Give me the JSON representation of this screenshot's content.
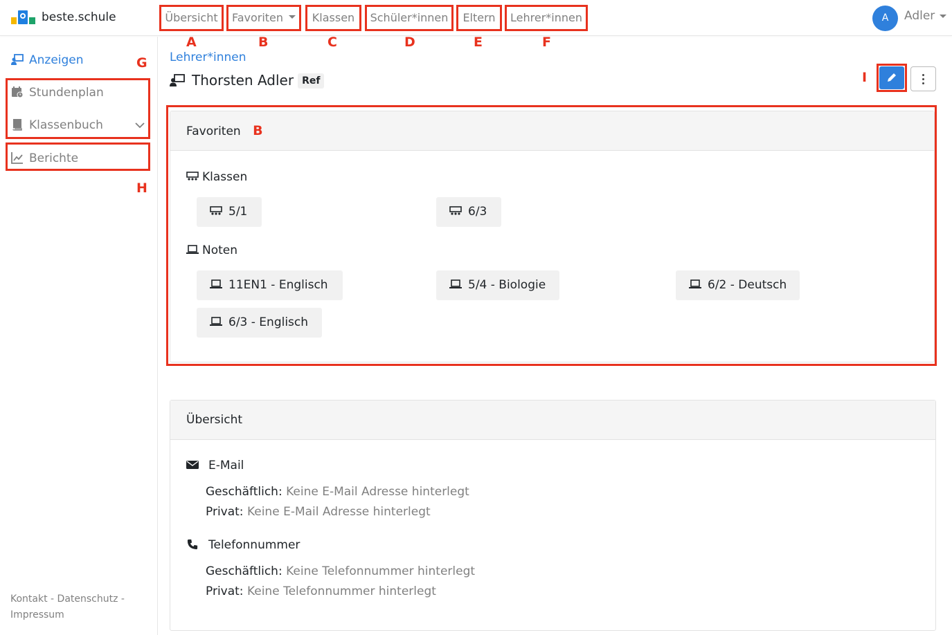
{
  "app": {
    "brand": "beste.schule"
  },
  "nav": {
    "items": [
      {
        "label": "Übersicht",
        "marker": "A"
      },
      {
        "label": "Favoriten",
        "marker": "B"
      },
      {
        "label": "Klassen",
        "marker": "C"
      },
      {
        "label": "Schüler*innen",
        "marker": "D"
      },
      {
        "label": "Eltern",
        "marker": "E"
      },
      {
        "label": "Lehrer*innen",
        "marker": "F"
      }
    ]
  },
  "user": {
    "initial": "A",
    "name": "Adler"
  },
  "sidebar": {
    "items": [
      {
        "label": "Anzeigen",
        "icon": "person-board-icon",
        "active": true
      },
      {
        "label": "Stundenplan",
        "icon": "calendar-clock-icon"
      },
      {
        "label": "Klassenbuch",
        "icon": "book-icon"
      },
      {
        "label": "Berichte",
        "icon": "chart-line-icon"
      }
    ],
    "markers": {
      "g": "G",
      "h": "H"
    },
    "footer": "Kontakt - Datenschutz - Impressum"
  },
  "page": {
    "breadcrumb": "Lehrer*innen",
    "title": "Thorsten Adler",
    "badge": "Ref",
    "edit_marker": "I"
  },
  "favoriten": {
    "title": "Favoriten",
    "marker": "B",
    "klassen_label": "Klassen",
    "klassen": [
      "5/1",
      "6/3"
    ],
    "noten_label": "Noten",
    "noten": [
      "11EN1 - Englisch",
      "5/4 - Biologie",
      "6/2 - Deutsch",
      "6/3 - Englisch"
    ]
  },
  "uebersicht": {
    "title": "Übersicht",
    "email_label": "E-Mail",
    "email_business_label": "Geschäftlich:",
    "email_business_value": "Keine E-Mail Adresse hinterlegt",
    "email_private_label": "Privat:",
    "email_private_value": "Keine E-Mail Adresse hinterlegt",
    "phone_label": "Telefonnummer",
    "phone_business_label": "Geschäftlich:",
    "phone_business_value": "Keine Telefonnummer hinterlegt",
    "phone_private_label": "Privat:",
    "phone_private_value": "Keine Telefonnummer hinterlegt"
  },
  "colors": {
    "accent": "#2f80dc",
    "annotation": "#e8321e"
  }
}
